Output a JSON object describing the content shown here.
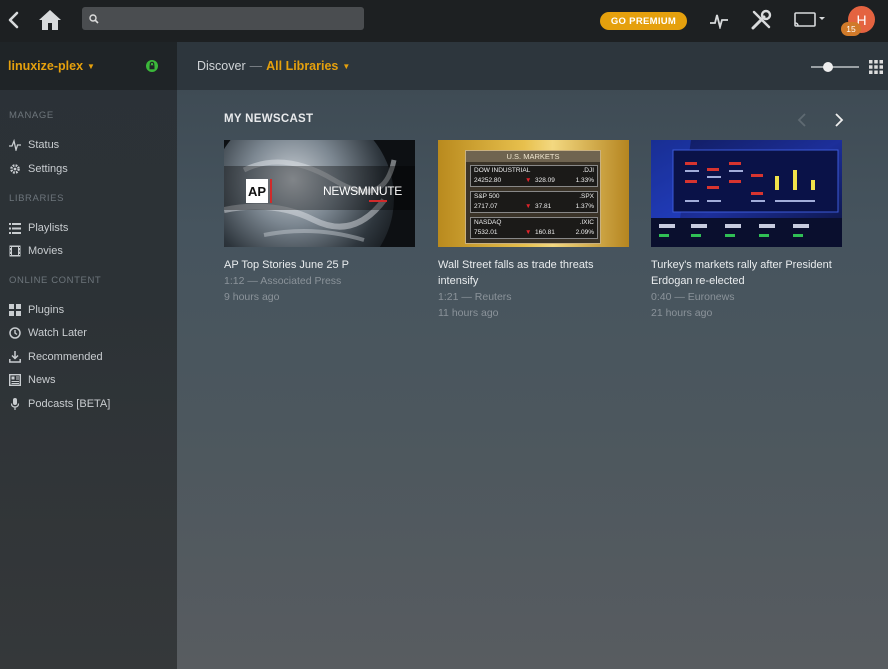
{
  "topbar": {
    "search_placeholder": "",
    "premium_label": "GO PREMIUM",
    "avatar_initial": "H",
    "badge_count": "15"
  },
  "sidebar": {
    "server_name": "linuxize-plex",
    "sections": [
      {
        "title": "MANAGE",
        "items": [
          {
            "label": "Status",
            "icon": "activity-icon"
          },
          {
            "label": "Settings",
            "icon": "gear-icon"
          }
        ]
      },
      {
        "title": "LIBRARIES",
        "items": [
          {
            "label": "Playlists",
            "icon": "list-icon"
          },
          {
            "label": "Movies",
            "icon": "film-icon"
          }
        ]
      },
      {
        "title": "ONLINE CONTENT",
        "items": [
          {
            "label": "Plugins",
            "icon": "grid-icon"
          },
          {
            "label": "Watch Later",
            "icon": "clock-icon"
          },
          {
            "label": "Recommended",
            "icon": "download-icon"
          },
          {
            "label": "News",
            "icon": "newspaper-icon"
          },
          {
            "label": "Podcasts [BETA]",
            "icon": "microphone-icon"
          }
        ]
      }
    ]
  },
  "header": {
    "discover": "Discover",
    "separator": "—",
    "library": "All Libraries"
  },
  "main": {
    "section_title": "MY NEWSCAST",
    "cards": [
      {
        "title": "AP Top Stories June 25 P",
        "meta": "1:12 — Associated Press",
        "age": "9 hours ago",
        "thumb": {
          "logo": "AP",
          "overlay": "NEWSMINUTE"
        }
      },
      {
        "title": "Wall Street falls as trade threats intensify",
        "meta": "1:21 — Reuters",
        "age": "11 hours ago",
        "thumb": {
          "header": "U.S. MARKETS",
          "rows": [
            {
              "name": "DOW INDUSTRIAL",
              "ticker": ".DJI",
              "price": "24252.80",
              "change": "328.09",
              "pct": "1.33%"
            },
            {
              "name": "S&P 500",
              "ticker": ".SPX",
              "price": "2717.07",
              "change": "37.81",
              "pct": "1.37%"
            },
            {
              "name": "NASDAQ",
              "ticker": ".IXIC",
              "price": "7532.01",
              "change": "160.81",
              "pct": "2.09%"
            }
          ]
        }
      },
      {
        "title": "Turkey's markets rally after President Erdogan re-elected",
        "meta": "0:40 — Euronews",
        "age": "21 hours ago",
        "thumb": {}
      }
    ]
  },
  "colors": {
    "accent": "#e5a00d",
    "avatar": "#e46340"
  }
}
